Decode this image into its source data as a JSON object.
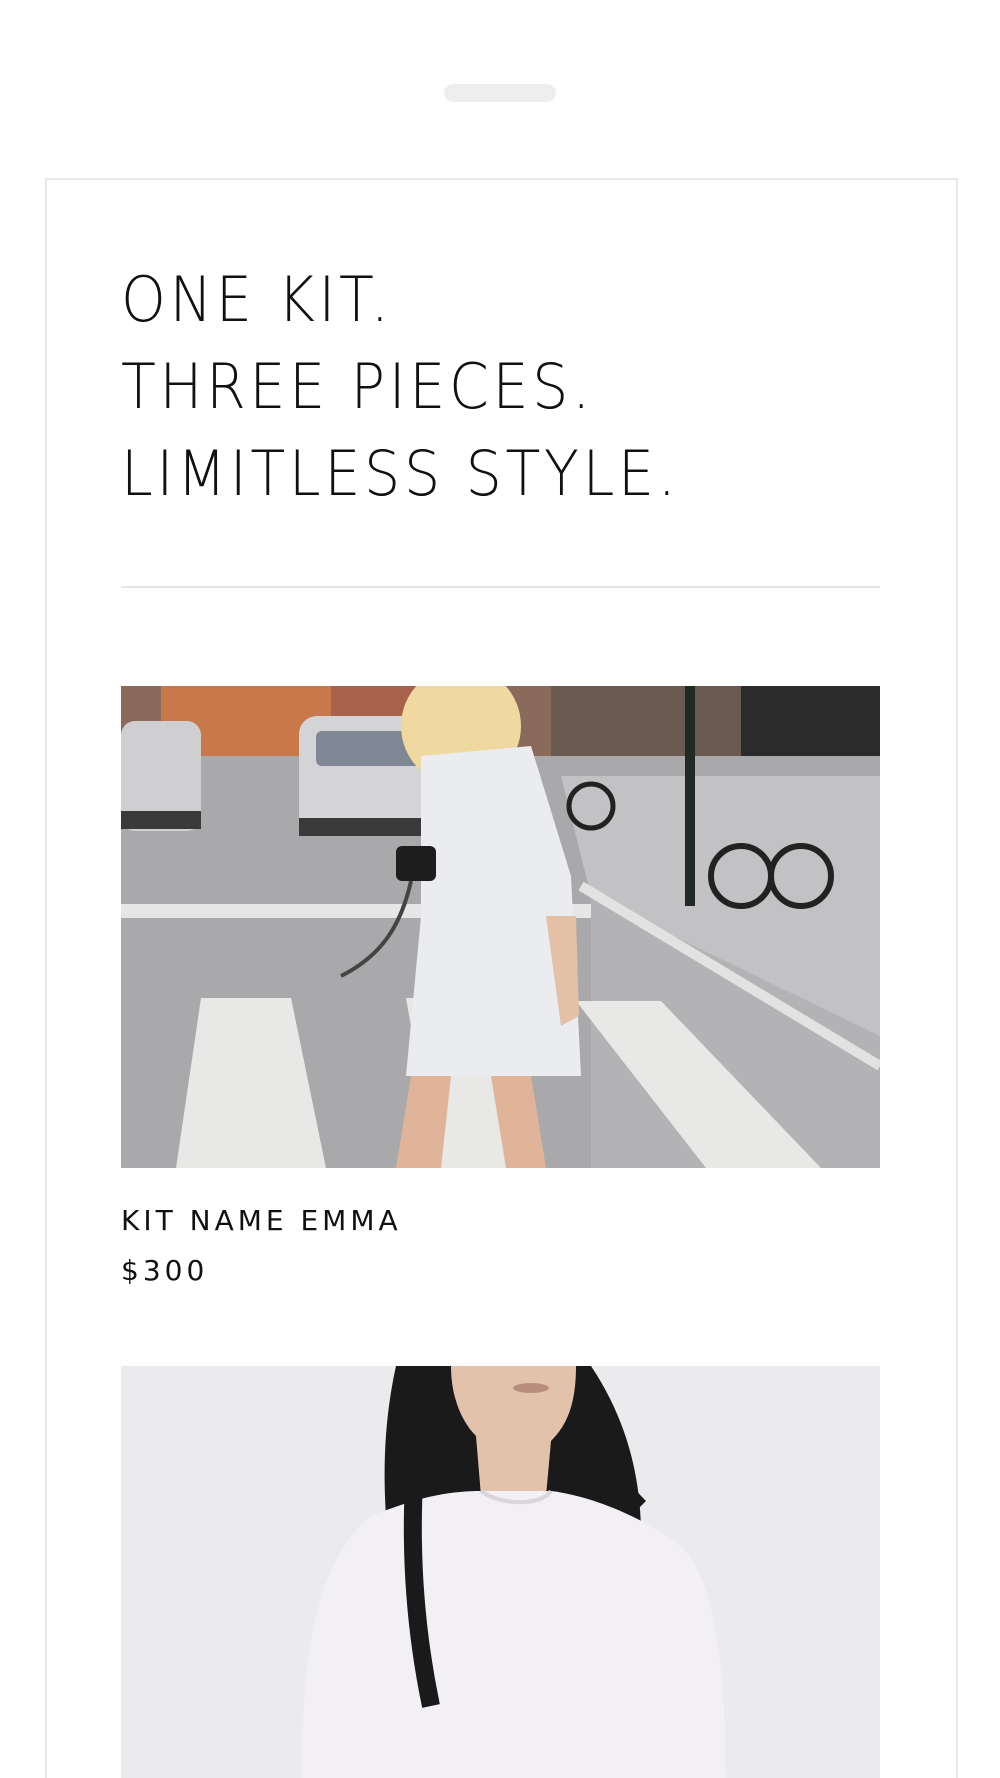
{
  "headline": {
    "line1": "ONE KIT.",
    "line2": "THREE PIECES.",
    "line3": "LIMITLESS STYLE."
  },
  "products": [
    {
      "name": "KIT NAME EMMA",
      "price": "$300",
      "image": "woman-in-white-shirt-dress-crossing-street-photo"
    },
    {
      "image": "woman-in-white-long-sleeve-top-photo"
    }
  ],
  "colors": {
    "text": "#111111",
    "divider": "#e6e6e6",
    "frame_border": "#e8e8e8",
    "studio_background": "#ebebed"
  }
}
